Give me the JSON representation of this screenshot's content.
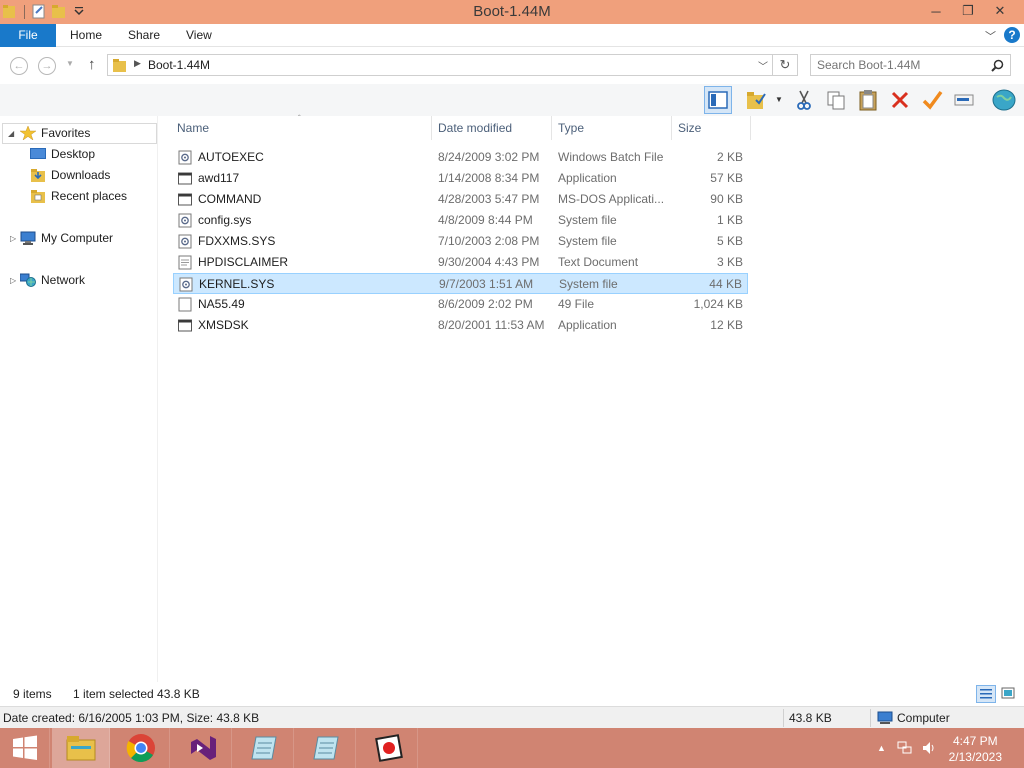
{
  "window": {
    "title": "Boot-1.44M"
  },
  "window_controls": {
    "minimize": "─",
    "maximize": "❐",
    "close": "✕"
  },
  "ribbon": {
    "tabs": [
      {
        "label": "File"
      },
      {
        "label": "Home"
      },
      {
        "label": "Share"
      },
      {
        "label": "View"
      }
    ],
    "help": "?"
  },
  "address": {
    "path": "Boot-1.44M",
    "search_placeholder": "Search Boot-1.44M"
  },
  "toolbar": {
    "icons": [
      "preview-pane-icon",
      "folder-options-icon",
      "cut-icon",
      "copy-icon",
      "paste-icon",
      "delete-icon",
      "checkmark-icon",
      "rename-icon",
      "globe-icon"
    ]
  },
  "navigation": {
    "favorites": "Favorites",
    "items": [
      "Desktop",
      "Downloads",
      "Recent places"
    ],
    "computer": "My Computer",
    "network": "Network"
  },
  "columns": {
    "name": "Name",
    "date": "Date modified",
    "type": "Type",
    "size": "Size"
  },
  "files": [
    {
      "name": "AUTOEXEC",
      "date": "8/24/2009 3:02 PM",
      "type": "Windows Batch File",
      "size": "2 KB",
      "icon": "batch-file-icon"
    },
    {
      "name": "awd117",
      "date": "1/14/2008 8:34 PM",
      "type": "Application",
      "size": "57 KB",
      "icon": "application-icon"
    },
    {
      "name": "COMMAND",
      "date": "4/28/2003 5:47 PM",
      "type": "MS-DOS Applicati...",
      "size": "90 KB",
      "icon": "application-icon"
    },
    {
      "name": "config.sys",
      "date": "4/8/2009 8:44 PM",
      "type": "System file",
      "size": "1 KB",
      "icon": "system-file-icon"
    },
    {
      "name": "FDXXMS.SYS",
      "date": "7/10/2003 2:08 PM",
      "type": "System file",
      "size": "5 KB",
      "icon": "system-file-icon"
    },
    {
      "name": "HPDISCLAIMER",
      "date": "9/30/2004 4:43 PM",
      "type": "Text Document",
      "size": "3 KB",
      "icon": "text-file-icon"
    },
    {
      "name": "KERNEL.SYS",
      "date": "9/7/2003 1:51 AM",
      "type": "System file",
      "size": "44 KB",
      "icon": "system-file-icon",
      "selected": true
    },
    {
      "name": "NA55.49",
      "date": "8/6/2009 2:02 PM",
      "type": "49 File",
      "size": "1,024 KB",
      "icon": "generic-file-icon"
    },
    {
      "name": "XMSDSK",
      "date": "8/20/2001 11:53 AM",
      "type": "Application",
      "size": "12 KB",
      "icon": "application-icon"
    }
  ],
  "status": {
    "item_count": "9 items",
    "selection": "1 item selected  43.8 KB"
  },
  "details": {
    "info": "Date created: 6/16/2005 1:03 PM, Size: 43.8 KB",
    "size": "43.8 KB",
    "location": "Computer"
  },
  "taskbar": {
    "apps": [
      "file-explorer-icon",
      "chrome-icon",
      "visual-studio-icon",
      "notepad-icon",
      "notepad-icon",
      "media-app-icon"
    ],
    "time": "4:47 PM",
    "date": "2/13/2023"
  },
  "colors": {
    "titlebar": "#f0a07c",
    "file_tab": "#1979ca",
    "selection": "#cce8ff",
    "taskbar": "#d08472"
  }
}
